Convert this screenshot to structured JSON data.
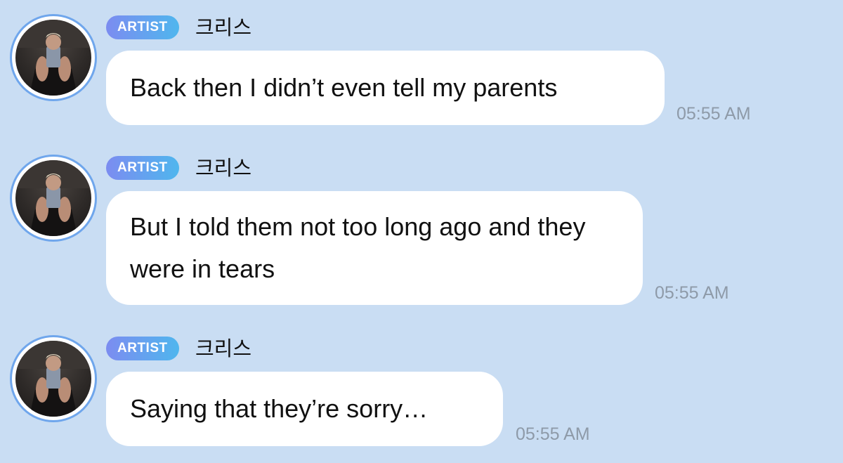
{
  "messages": [
    {
      "badge": "ARTIST",
      "sender": "크리스",
      "text": "Back then I didn’t even tell my parents",
      "time": "05:55 AM"
    },
    {
      "badge": "ARTIST",
      "sender": "크리스",
      "text": "But I told them not too long ago and they were in tears",
      "time": "05:55 AM"
    },
    {
      "badge": "ARTIST",
      "sender": "크리스",
      "text": "Saying that they’re sorry…",
      "time": "05:55 AM"
    }
  ],
  "colors": {
    "background": "#c9ddf3",
    "bubble": "#ffffff",
    "badge_start": "#7c8cf0",
    "badge_end": "#4fb6ee",
    "avatar_ring": "#6fa6ec",
    "timestamp": "#8e9aa8"
  }
}
